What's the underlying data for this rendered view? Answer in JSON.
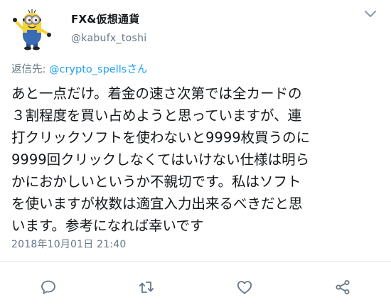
{
  "user": {
    "display_name": "FX&仮想通貨",
    "handle": "@kabufx_toshi"
  },
  "tweet": {
    "reply_prefix": "返信先: ",
    "reply_mention": "@crypto_spellsさん",
    "lines": [
      "あと一点だけ。着金の速さ次第では全カードの",
      "３割程度を買い占めようと思っていますが、連",
      "打クリックソフトを使わないと9999枚買うのに",
      "9999回クリックしなくてはいけない仕様は明ら",
      "かにおかしいというか不親切です。私はソフト",
      "を使いますが枚数は適宜入力出来るべきだと思",
      "います。参考になれば幸いです"
    ],
    "timestamp": "2018年10月01日 21:40"
  },
  "icons": {
    "menu": "chevron-down-icon",
    "reply": "reply-icon",
    "retweet": "retweet-icon",
    "like": "heart-icon",
    "share": "share-icon"
  },
  "colors": {
    "text": "#14171a",
    "secondary": "#657786",
    "link": "#1da1f2",
    "divider": "#e6ecf0"
  }
}
